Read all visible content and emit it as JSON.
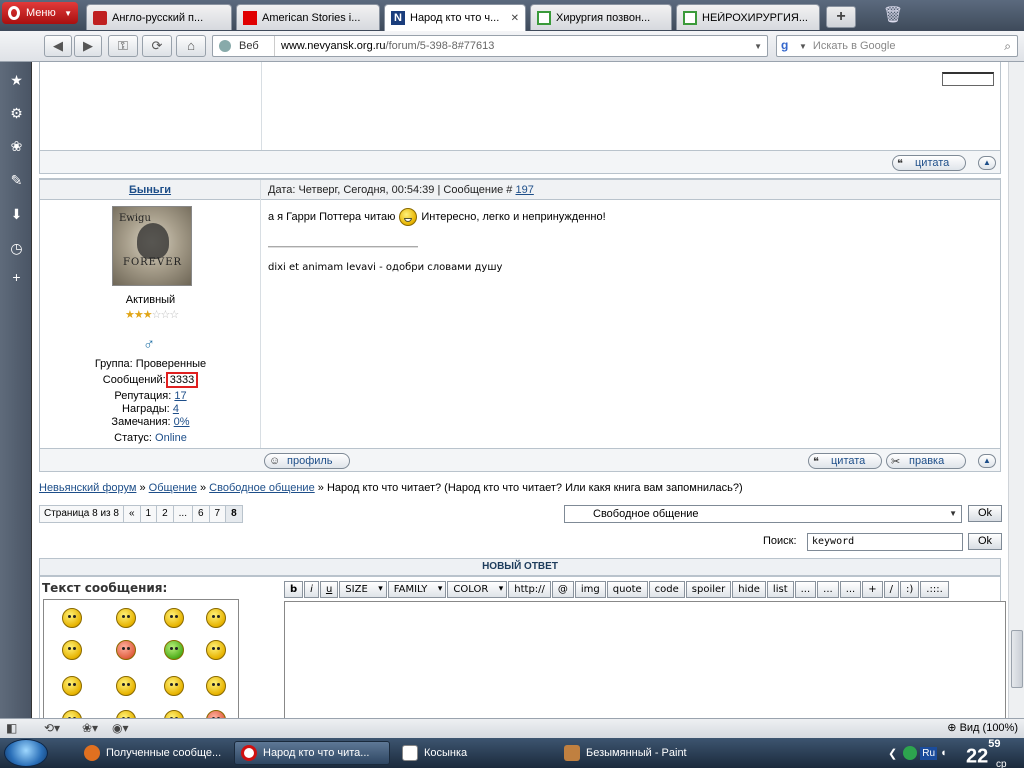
{
  "browser": {
    "menu_label": "Меню",
    "tabs": [
      {
        "title": "Англо-русский п...",
        "icon_color": "#c02020"
      },
      {
        "title": "American Stories i...",
        "icon_color": "#e00000"
      },
      {
        "title": "Народ кто что ч...",
        "icon_color": "#1a3d7c",
        "active": true
      },
      {
        "title": "Хирургия позвон...",
        "icon_color": "#3a9a3a"
      },
      {
        "title": "НЕЙРОХИРУРГИЯ...",
        "icon_color": "#3a9a3a"
      }
    ],
    "tab_close": "✕",
    "newtab": "+",
    "address": {
      "mode_label": "Веб",
      "domain": "www.nevyansk.org.ru",
      "path": "/forum/5-398-8#77613"
    },
    "search_placeholder": "Искать в Google"
  },
  "post_prev": {
    "quote_label": "цитата"
  },
  "post": {
    "author": "Быньги",
    "date_prefix": "Дата: Четверг, Сегодня, 00:54:39 | Сообщение # ",
    "message_number": "197",
    "message_before": "а я Гарри Поттера читаю",
    "message_after": "Интересно, легко и непринужденно!",
    "signature": "dixi et animam levavi - одобри словами душу",
    "avatar_text_top": "Ewigu",
    "avatar_text_bottom": "FOREVER",
    "rank": "Активный",
    "stars_on": "★★★",
    "stars_off": "☆☆☆",
    "gender_symbol": "♂",
    "group_label": "Группа: Проверенные",
    "messages_label": "Сообщений:",
    "messages_count": "3333",
    "reputation_label": "Репутация:",
    "reputation_value": "17",
    "awards_label": "Награды:",
    "awards_value": "4",
    "warnings_label": "Замечания:",
    "warnings_value": "0%",
    "status_label": "Статус:",
    "status_value": "Online",
    "profile_label": "профиль",
    "quote_label": "цитата",
    "edit_label": "правка"
  },
  "breadcrumb": {
    "items": [
      "Невьянский форум",
      "Общение",
      "Свободное общение"
    ],
    "separator": " » ",
    "current": "Народ кто что читает? (Народ кто что читает? Или какя книга вам запомнилась?)"
  },
  "pager": {
    "label": "Страница 8 из 8",
    "prev": "«",
    "pages": [
      "1",
      "2",
      "...",
      "6",
      "7",
      "8"
    ],
    "current": "8"
  },
  "jump": {
    "selected": "Свободное общение",
    "ok": "Ok"
  },
  "search": {
    "label": "Поиск:",
    "value": "keyword",
    "ok": "Ok"
  },
  "reply": {
    "header": "НОВЫЙ ОТВЕТ",
    "text_label": "Текст сообщения:",
    "toolbar": [
      "b",
      "i",
      "u",
      "SIZE",
      "FAMILY",
      "COLOR",
      "http://",
      "@",
      "img",
      "quote",
      "code",
      "spoiler",
      "hide",
      "list",
      "...",
      "...",
      "...",
      "+",
      "/",
      ":)",
      ".:::."
    ]
  },
  "statusbar": {
    "zoom": "Вид (100%)"
  },
  "taskbar": {
    "items": [
      {
        "label": "Полученные сообще...",
        "icon_color": "#e07020"
      },
      {
        "label": "Народ кто что чита...",
        "icon_color": "#d01010",
        "active": true
      },
      {
        "label": "Косынка",
        "icon_color": "#ffffff"
      },
      {
        "label": "Безымянный - Paint",
        "icon_color": "#c08040"
      }
    ],
    "lang": "Ru",
    "clock_hour": "22",
    "clock_min": "59",
    "clock_day": "ср"
  }
}
